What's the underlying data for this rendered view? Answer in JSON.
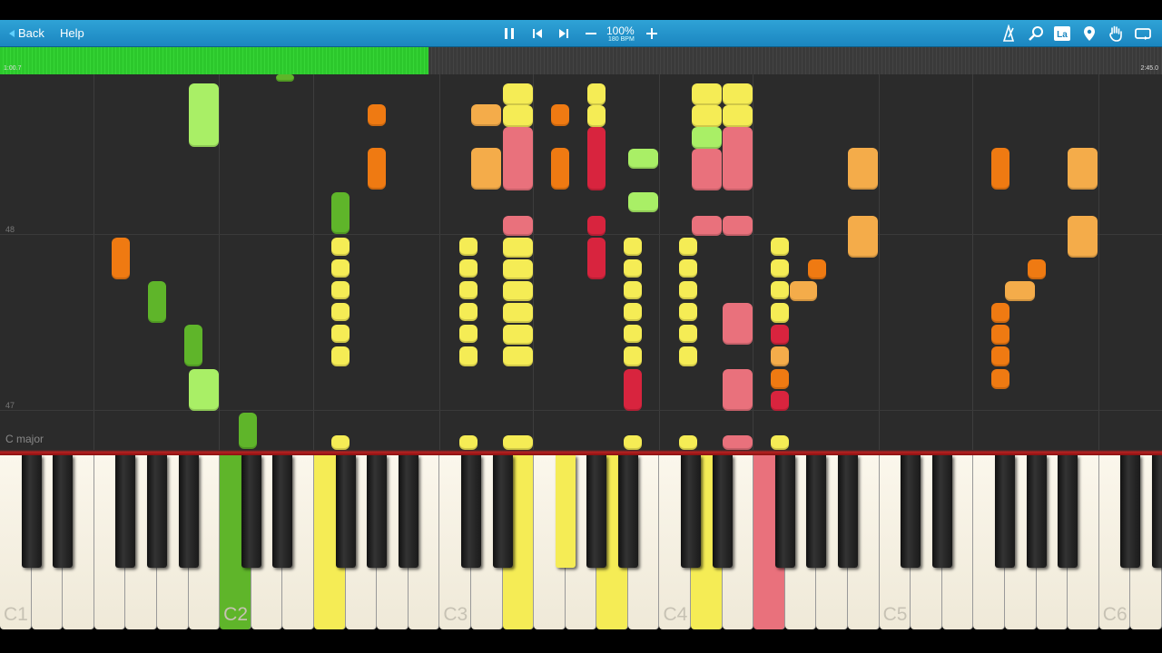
{
  "toolbar": {
    "back_label": "Back",
    "help_label": "Help",
    "speed_percent": "100%",
    "tempo_bpm": "180 BPM"
  },
  "timeline": {
    "elapsed": "1:00.7",
    "total": "2:45.0",
    "progress_fraction": 0.369
  },
  "roll": {
    "measure_numbers": [
      "48",
      "47"
    ],
    "key_signature": "C major"
  },
  "keyboard": {
    "octave_labels": [
      "C1",
      "C2",
      "C3",
      "C4",
      "C5",
      "C6"
    ]
  },
  "colors": {
    "toolbar_blue": "#1f90c8",
    "progress_green": "#33d033",
    "note_yellow": "#f5ec55",
    "note_green": "#a9ef66",
    "note_dark_green": "#5fb52a",
    "note_orange": "#ef7a12",
    "note_light_orange": "#f4ac4a",
    "note_pink": "#e9717c",
    "note_red": "#d8243e"
  },
  "icons": {
    "toolbar_center": [
      "pause-icon",
      "skip-back-icon",
      "skip-forward-icon",
      "minus-icon",
      "plus-icon"
    ],
    "toolbar_right": [
      "metronome-icon",
      "search-icon",
      "label-icon",
      "location-pin-icon",
      "hand-icon",
      "loop-icon"
    ]
  }
}
